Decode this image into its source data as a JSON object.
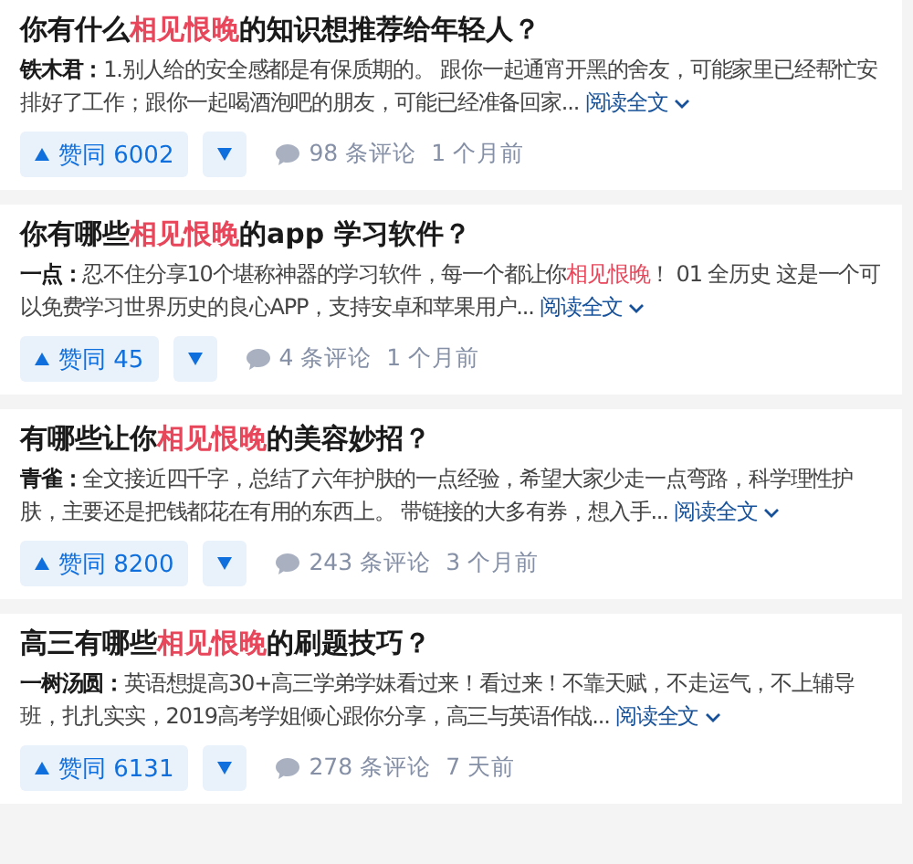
{
  "cards": [
    {
      "title": [
        {
          "text": "你有什么",
          "highlight": false
        },
        {
          "text": "相见恨晚",
          "highlight": true
        },
        {
          "text": "的知识想推荐给年轻人？",
          "highlight": false
        }
      ],
      "author": "铁木君：",
      "excerpt": [
        {
          "text": "1.别人给的安全感都是有保质期的。 跟你一起通宵开黑的舍友，可能家里已经帮忙安排好了工作；跟你一起喝酒泡吧的朋友，可能已经准备回家...",
          "highlight": false
        }
      ],
      "read_more": "阅读全文",
      "votes": "赞同 6002",
      "comments": "98 条评论",
      "time": "1 个月前"
    },
    {
      "title": [
        {
          "text": "你有哪些",
          "highlight": false
        },
        {
          "text": "相见恨晚",
          "highlight": true
        },
        {
          "text": "的app 学习软件？",
          "highlight": false
        }
      ],
      "author": "一点：",
      "excerpt": [
        {
          "text": "忍不住分享10个堪称神器的学习软件，每一个都让你",
          "highlight": false
        },
        {
          "text": "相见恨晚",
          "highlight": true
        },
        {
          "text": "！ 01 全历史 这是一个可以免费学习世界历史的良心APP，支持安卓和苹果用户...",
          "highlight": false
        }
      ],
      "read_more": "阅读全文",
      "votes": "赞同 45",
      "comments": "4 条评论",
      "time": "1 个月前"
    },
    {
      "title": [
        {
          "text": "有哪些让你",
          "highlight": false
        },
        {
          "text": "相见恨晚",
          "highlight": true
        },
        {
          "text": "的美容妙招？",
          "highlight": false
        }
      ],
      "author": "青雀：",
      "excerpt": [
        {
          "text": "全文接近四千字，总结了六年护肤的一点经验，希望大家少走一点弯路，科学理性护肤，主要还是把钱都花在有用的东西上。 带链接的大多有券，想入手...",
          "highlight": false
        }
      ],
      "read_more": "阅读全文",
      "votes": "赞同 8200",
      "comments": "243 条评论",
      "time": "3 个月前"
    },
    {
      "title": [
        {
          "text": "高三有哪些",
          "highlight": false
        },
        {
          "text": "相见恨晚",
          "highlight": true
        },
        {
          "text": "的刷题技巧？",
          "highlight": false
        }
      ],
      "author": "一树汤圆：",
      "excerpt": [
        {
          "text": "英语想提高30+高三学弟学妹看过来！看过来！不靠天赋，不走运气，不上辅导班，扎扎实实，2019高考学姐倾心跟你分享，高三与英语作战...",
          "highlight": false
        }
      ],
      "read_more": "阅读全文",
      "votes": "赞同 6131",
      "comments": "278 条评论",
      "time": "7 天前"
    }
  ]
}
